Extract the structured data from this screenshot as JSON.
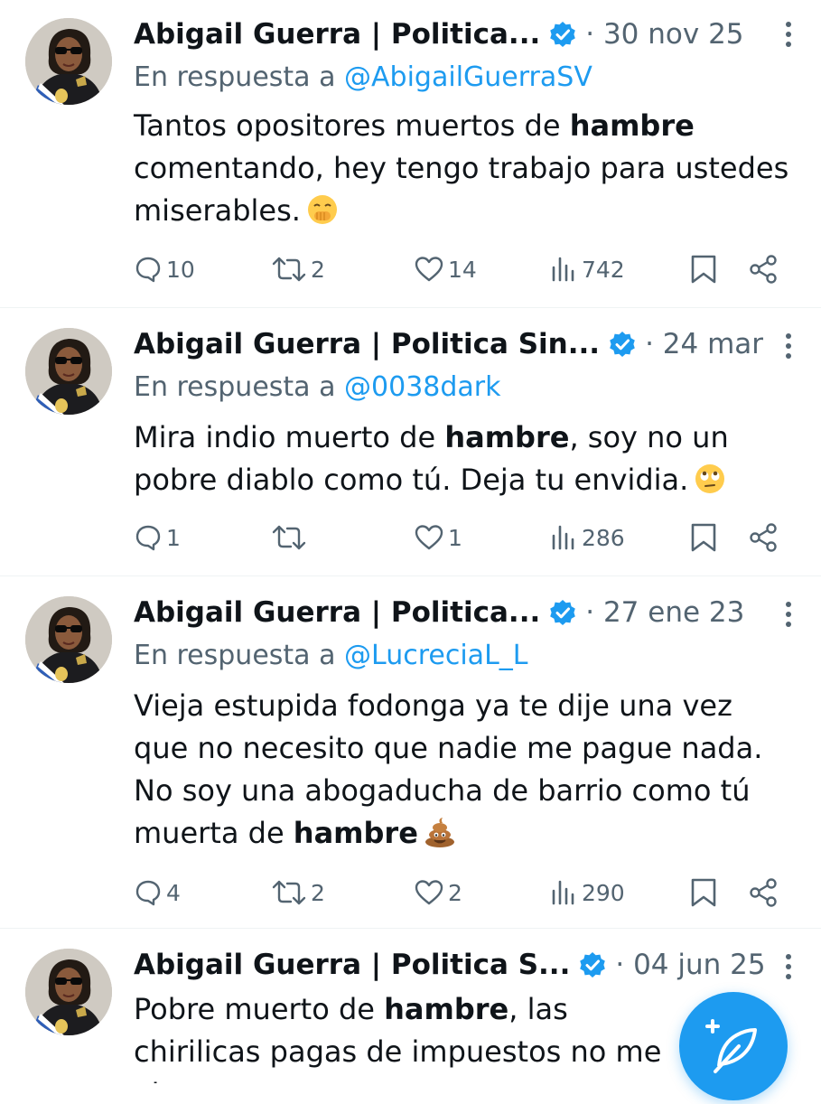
{
  "colors": {
    "accent": "#1d9bf0",
    "text": "#0f1419",
    "muted": "#536471",
    "divider": "#eff3f4"
  },
  "tweets": [
    {
      "name": "Abigail Guerra | Politica...",
      "date": "· 30 nov 25",
      "reply_prefix": "En respuesta a",
      "reply_handle": "@AbigailGuerraSV",
      "text_a": "Tantos opositores muertos de ",
      "bold": "hambre",
      "text_b": " comentando, hey tengo trabajo para ustedes miserables.",
      "emoji": "face-with-hand-over-mouth",
      "replies": "10",
      "retweets": "2",
      "likes": "14",
      "views": "742"
    },
    {
      "name": "Abigail Guerra | Politica Sin...",
      "date": "· 24 mar",
      "reply_prefix": "En respuesta a",
      "reply_handle": "@0038dark",
      "text_a": "Mira indio muerto de ",
      "bold": "hambre",
      "text_b": ", soy no un pobre diablo como tú. Deja tu envidia.",
      "emoji": "face-with-rolling-eyes",
      "replies": "1",
      "retweets": "",
      "likes": "1",
      "views": "286"
    },
    {
      "name": "Abigail Guerra | Politica...",
      "date": "· 27 ene 23",
      "reply_prefix": "En respuesta a",
      "reply_handle": "@LucreciaL_L",
      "text_a": "Vieja estupida fodonga ya te dije una vez que no necesito que nadie me pague nada. No soy una abogaducha de barrio como tú muerta de ",
      "bold": "hambre",
      "text_b": "",
      "emoji": "pile-of-poo",
      "replies": "4",
      "retweets": "2",
      "likes": "2",
      "views": "290"
    },
    {
      "name": "Abigail Guerra | Politica S...",
      "date": "· 04 jun 25",
      "text_a": "Pobre muerto de ",
      "bold": "hambre",
      "text_b": ", las chirilicas pagas de impuestos no me alcanzan"
    }
  ],
  "fab": {
    "icon": "compose-feather-plus-icon"
  }
}
